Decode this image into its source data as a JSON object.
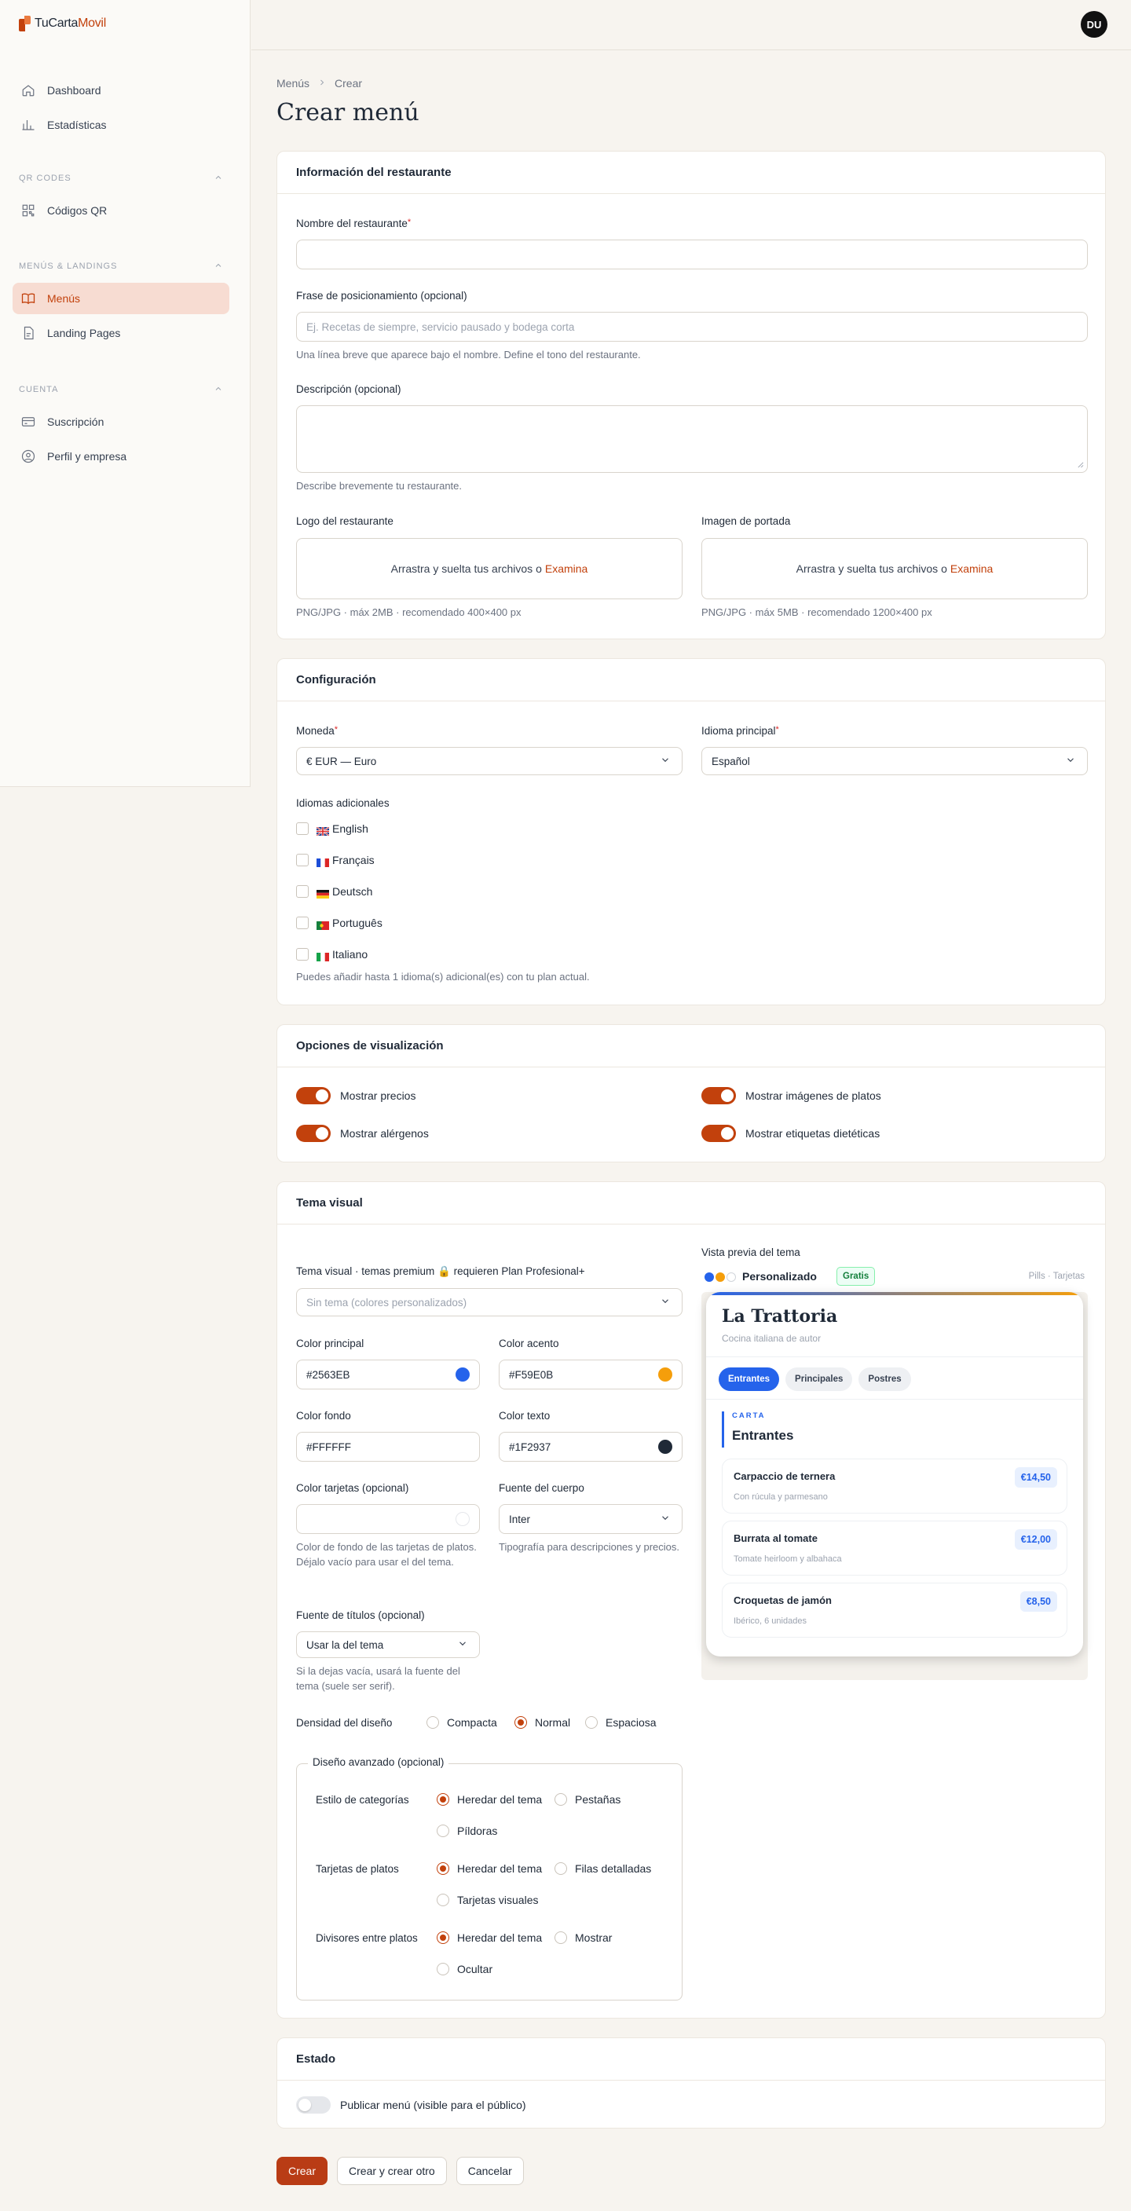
{
  "brand": {
    "name_part1": "TuCarta",
    "name_part2": "Movil"
  },
  "user": {
    "initials": "DU"
  },
  "sidebar": {
    "top_items": [
      {
        "label": "Dashboard",
        "icon": "home-icon"
      },
      {
        "label": "Estadísticas",
        "icon": "bar-chart-icon"
      }
    ],
    "sections": [
      {
        "title": "QR CODES",
        "items": [
          {
            "label": "Códigos QR",
            "icon": "qr-icon"
          }
        ]
      },
      {
        "title": "MENÚS & LANDINGS",
        "items": [
          {
            "label": "Menús",
            "icon": "book-icon",
            "active": true
          },
          {
            "label": "Landing Pages",
            "icon": "file-icon"
          }
        ]
      },
      {
        "title": "CUENTA",
        "items": [
          {
            "label": "Suscripción",
            "icon": "card-icon"
          },
          {
            "label": "Perfil y empresa",
            "icon": "user-circle-icon"
          }
        ]
      }
    ]
  },
  "breadcrumb": {
    "parent": "Menús",
    "current": "Crear"
  },
  "page_title": "Crear menú",
  "restaurant": {
    "title": "Información del restaurante",
    "name_label": "Nombre del restaurante",
    "name_value": "",
    "tagline_label": "Frase de posicionamiento (opcional)",
    "tagline_placeholder": "Ej. Recetas de siempre, servicio pausado y bodega corta",
    "tagline_hint": "Una línea breve que aparece bajo el nombre. Define el tono del restaurante.",
    "description_label": "Descripción (opcional)",
    "description_hint": "Describe brevemente tu restaurante.",
    "logo_label": "Logo del restaurante",
    "logo_drop": "Arrastra y suelta tus archivos o",
    "logo_link": "Examina",
    "logo_hint": "PNG/JPG · máx 2MB · recomendado 400×400 px",
    "cover_label": "Imagen de portada",
    "cover_drop": "Arrastra y suelta tus archivos o",
    "cover_link": "Examina",
    "cover_hint": "PNG/JPG · máx 5MB · recomendado 1200×400 px"
  },
  "config": {
    "title": "Configuración",
    "currency_label": "Moneda",
    "currency_value": "€ EUR — Euro",
    "language_label": "Idioma principal",
    "language_value": "Español",
    "extra_languages_label": "Idiomas adicionales",
    "languages": [
      {
        "label": "English",
        "flag": "gb"
      },
      {
        "label": "Français",
        "flag": "fr"
      },
      {
        "label": "Deutsch",
        "flag": "de"
      },
      {
        "label": "Português",
        "flag": "pt"
      },
      {
        "label": "Italiano",
        "flag": "it"
      }
    ],
    "languages_hint": "Puedes añadir hasta 1 idioma(s) adicional(es) con tu plan actual."
  },
  "display": {
    "title": "Opciones de visualización",
    "options": [
      {
        "label": "Mostrar precios",
        "on": true
      },
      {
        "label": "Mostrar imágenes de platos",
        "on": true
      },
      {
        "label": "Mostrar alérgenos",
        "on": true
      },
      {
        "label": "Mostrar etiquetas dietéticas",
        "on": true
      }
    ]
  },
  "theme": {
    "title": "Tema visual",
    "theme_label": "Tema visual · temas premium 🔒 requieren Plan Profesional+",
    "theme_placeholder": "Sin tema (colores personalizados)",
    "primary_label": "Color principal",
    "primary_value": "#2563EB",
    "accent_label": "Color acento",
    "accent_value": "#F59E0B",
    "bg_label": "Color fondo",
    "bg_value": "#FFFFFF",
    "text_label": "Color texto",
    "text_value": "#1F2937",
    "cards_label": "Color tarjetas (opcional)",
    "cards_value": "",
    "cards_hint": "Color de fondo de las tarjetas de platos. Déjalo vacío para usar el del tema.",
    "body_font_label": "Fuente del cuerpo",
    "body_font_value": "Inter",
    "body_font_hint": "Tipografía para descripciones y precios.",
    "title_font_label": "Fuente de títulos (opcional)",
    "title_font_value": "Usar la del tema",
    "title_font_hint": "Si la dejas vacía, usará la fuente del tema (suele ser serif).",
    "density_label": "Densidad del diseño",
    "density_options": [
      "Compacta",
      "Normal",
      "Espaciosa"
    ],
    "advanced_title": "Diseño avanzado (opcional)",
    "category_style_label": "Estilo de categorías",
    "category_style_options": [
      "Heredar del tema",
      "Pestañas",
      "Píldoras"
    ],
    "dish_cards_label": "Tarjetas de platos",
    "dish_cards_options": [
      "Heredar del tema",
      "Filas detalladas",
      "Tarjetas visuales"
    ],
    "dividers_label": "Divisores entre platos",
    "dividers_options": [
      "Heredar del tema",
      "Mostrar",
      "Ocultar"
    ],
    "colors": {
      "primary": "#2563EB",
      "accent": "#F59E0B",
      "text": "#1F2937",
      "brand": "#C2410C"
    }
  },
  "preview": {
    "label": "Vista previa del tema",
    "theme_name": "Personalizado",
    "badge": "Gratis",
    "meta": "Pills · Tarjetas",
    "restaurant_name": "La Trattoria",
    "restaurant_tagline": "Cocina italiana de autor",
    "tabs": [
      "Entrantes",
      "Principales",
      "Postres"
    ],
    "section_kicker": "CARTA",
    "section_title": "Entrantes",
    "dishes": [
      {
        "name": "Carpaccio de ternera",
        "desc": "Con rúcula y parmesano",
        "price": "€14,50"
      },
      {
        "name": "Burrata al tomate",
        "desc": "Tomate heirloom y albahaca",
        "price": "€12,00"
      },
      {
        "name": "Croquetas de jamón",
        "desc": "Ibérico, 6 unidades",
        "price": "€8,50"
      }
    ]
  },
  "status": {
    "title": "Estado",
    "publish_label": "Publicar menú (visible para el público)"
  },
  "actions": {
    "create": "Crear",
    "create_another": "Crear y crear otro",
    "cancel": "Cancelar"
  }
}
